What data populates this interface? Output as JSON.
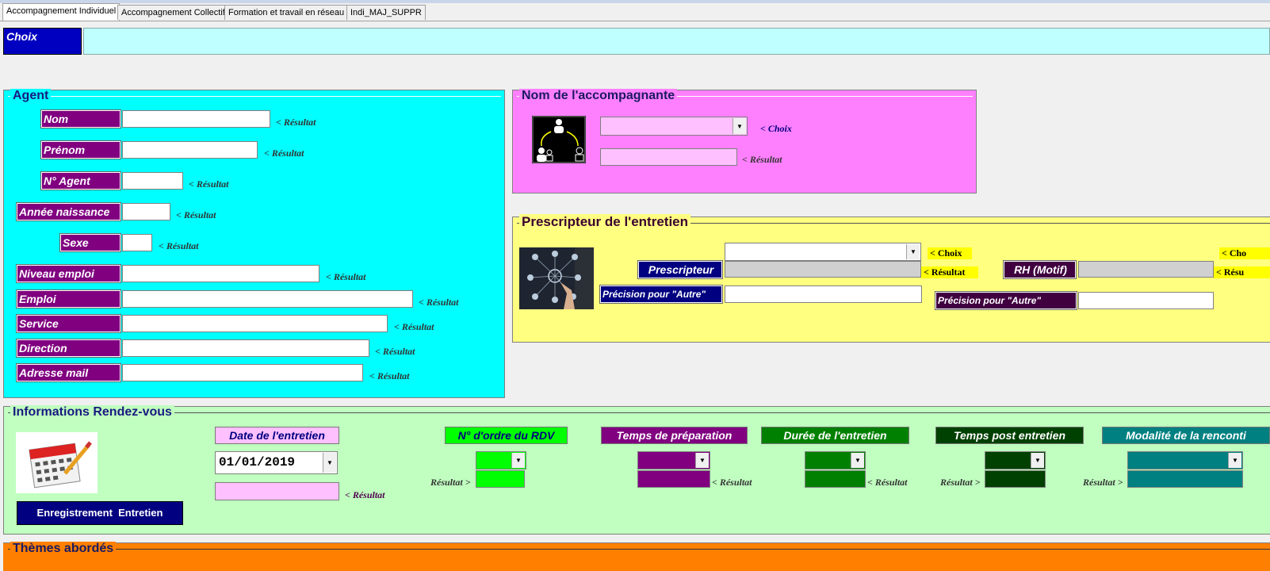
{
  "tabs": [
    "Accompagnement Individuel",
    "Accompagnement Collectif",
    "Formation et travail en réseau",
    "Indi_MAJ_SUPPR"
  ],
  "choix": {
    "label": "Choix",
    "value": ""
  },
  "agent": {
    "title": "Agent",
    "fields": [
      {
        "label": "Nom",
        "value": "",
        "result": "< Résultat"
      },
      {
        "label": "Prénom",
        "value": "",
        "result": "< Résultat"
      },
      {
        "label": "N° Agent",
        "value": "",
        "result": "< Résultat"
      },
      {
        "label": "Année naissance",
        "value": "",
        "result": "< Résultat"
      },
      {
        "label": "Sexe",
        "value": "",
        "result": "< Résultat"
      },
      {
        "label": "Niveau emploi",
        "value": "",
        "result": "< Résultat"
      },
      {
        "label": "Emploi",
        "value": "",
        "result": "< Résultat"
      },
      {
        "label": "Service",
        "value": "",
        "result": "< Résultat"
      },
      {
        "label": "Direction",
        "value": "",
        "result": "< Résultat"
      },
      {
        "label": "Adresse mail",
        "value": "",
        "result": "< Résultat"
      }
    ]
  },
  "accompagnante": {
    "title": "Nom de l'accompagnante",
    "choix_tag": "< Choix",
    "result_tag": "< Résultat",
    "combo_value": "",
    "result_value": ""
  },
  "prescripteur": {
    "title": "Prescripteur de l'entretien",
    "choix_tag": "< Choix",
    "result_tag": "< Résultat",
    "prescripteur_label": "Prescripteur",
    "precision_label": "Précision pour \"Autre\"",
    "rh_label": "RH (Motif)",
    "rh_choix_tag": "< Cho",
    "rh_result_tag": "< Résu",
    "rh_precision_label": "Précision pour \"Autre\""
  },
  "rdv": {
    "title": "Informations Rendez-vous",
    "date_label": "Date de l'entretien",
    "date_value": "01/01/2019",
    "date_result": "< Résultat",
    "save_button": "Enregistrement  Entretien",
    "columns": [
      {
        "label": "N° d'ordre du RDV",
        "color": "#00ff00",
        "text_color": "#000080",
        "result_prefix": "Résultat >",
        "result_suffix": ""
      },
      {
        "label": "Temps de préparation",
        "color": "#800080",
        "text_color": "#ffffff",
        "result_prefix": "",
        "result_suffix": "< Résultat"
      },
      {
        "label": "Durée de l'entretien",
        "color": "#008000",
        "text_color": "#ffffff",
        "result_prefix": "",
        "result_suffix": "< Résultat"
      },
      {
        "label": "Temps post entretien",
        "color": "#004000",
        "text_color": "#ffffff",
        "result_prefix": "Résultat >",
        "result_suffix": ""
      },
      {
        "label": "Modalité de la renconti",
        "color": "#008080",
        "text_color": "#ffffff",
        "result_prefix": "Résultat >",
        "result_suffix": ""
      }
    ]
  },
  "themes": {
    "title": "Thèmes abordés"
  },
  "colors": {
    "agent_bg": "#00ffff",
    "accompagnante_bg": "#ff80ff",
    "prescripteur_bg": "#ffff80",
    "rdv_bg": "#c0ffc0",
    "themes_bg": "#ff8000",
    "label_purple": "#800080",
    "label_navy": "#000080"
  },
  "icons": {
    "accompagnante": "people-network-icon",
    "prescripteur": "network-hand-icon",
    "rdv": "calendar-icon"
  }
}
